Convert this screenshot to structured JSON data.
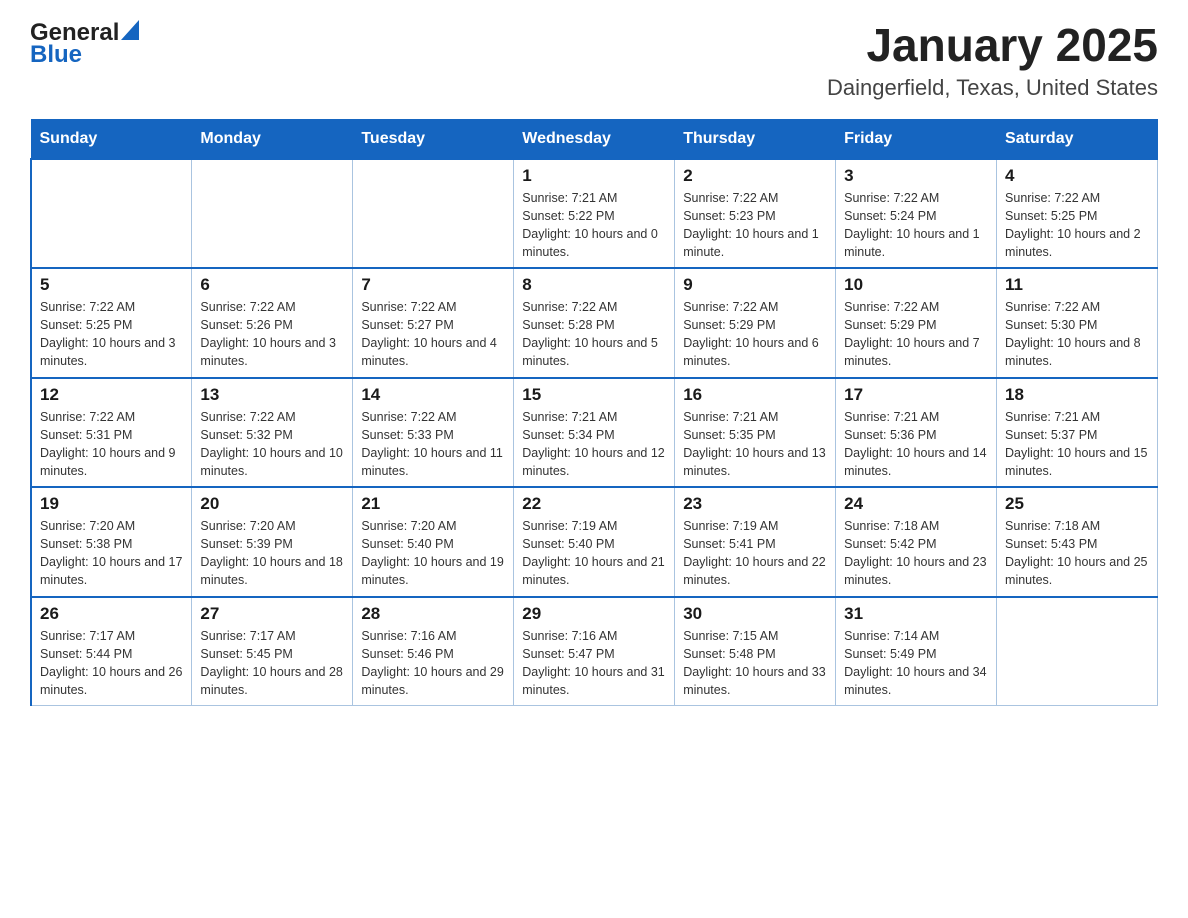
{
  "header": {
    "logo_general": "General",
    "logo_blue": "Blue",
    "title": "January 2025",
    "subtitle": "Daingerfield, Texas, United States"
  },
  "weekdays": [
    "Sunday",
    "Monday",
    "Tuesday",
    "Wednesday",
    "Thursday",
    "Friday",
    "Saturday"
  ],
  "weeks": [
    [
      {
        "day": "",
        "info": ""
      },
      {
        "day": "",
        "info": ""
      },
      {
        "day": "",
        "info": ""
      },
      {
        "day": "1",
        "info": "Sunrise: 7:21 AM\nSunset: 5:22 PM\nDaylight: 10 hours and 0 minutes."
      },
      {
        "day": "2",
        "info": "Sunrise: 7:22 AM\nSunset: 5:23 PM\nDaylight: 10 hours and 1 minute."
      },
      {
        "day": "3",
        "info": "Sunrise: 7:22 AM\nSunset: 5:24 PM\nDaylight: 10 hours and 1 minute."
      },
      {
        "day": "4",
        "info": "Sunrise: 7:22 AM\nSunset: 5:25 PM\nDaylight: 10 hours and 2 minutes."
      }
    ],
    [
      {
        "day": "5",
        "info": "Sunrise: 7:22 AM\nSunset: 5:25 PM\nDaylight: 10 hours and 3 minutes."
      },
      {
        "day": "6",
        "info": "Sunrise: 7:22 AM\nSunset: 5:26 PM\nDaylight: 10 hours and 3 minutes."
      },
      {
        "day": "7",
        "info": "Sunrise: 7:22 AM\nSunset: 5:27 PM\nDaylight: 10 hours and 4 minutes."
      },
      {
        "day": "8",
        "info": "Sunrise: 7:22 AM\nSunset: 5:28 PM\nDaylight: 10 hours and 5 minutes."
      },
      {
        "day": "9",
        "info": "Sunrise: 7:22 AM\nSunset: 5:29 PM\nDaylight: 10 hours and 6 minutes."
      },
      {
        "day": "10",
        "info": "Sunrise: 7:22 AM\nSunset: 5:29 PM\nDaylight: 10 hours and 7 minutes."
      },
      {
        "day": "11",
        "info": "Sunrise: 7:22 AM\nSunset: 5:30 PM\nDaylight: 10 hours and 8 minutes."
      }
    ],
    [
      {
        "day": "12",
        "info": "Sunrise: 7:22 AM\nSunset: 5:31 PM\nDaylight: 10 hours and 9 minutes."
      },
      {
        "day": "13",
        "info": "Sunrise: 7:22 AM\nSunset: 5:32 PM\nDaylight: 10 hours and 10 minutes."
      },
      {
        "day": "14",
        "info": "Sunrise: 7:22 AM\nSunset: 5:33 PM\nDaylight: 10 hours and 11 minutes."
      },
      {
        "day": "15",
        "info": "Sunrise: 7:21 AM\nSunset: 5:34 PM\nDaylight: 10 hours and 12 minutes."
      },
      {
        "day": "16",
        "info": "Sunrise: 7:21 AM\nSunset: 5:35 PM\nDaylight: 10 hours and 13 minutes."
      },
      {
        "day": "17",
        "info": "Sunrise: 7:21 AM\nSunset: 5:36 PM\nDaylight: 10 hours and 14 minutes."
      },
      {
        "day": "18",
        "info": "Sunrise: 7:21 AM\nSunset: 5:37 PM\nDaylight: 10 hours and 15 minutes."
      }
    ],
    [
      {
        "day": "19",
        "info": "Sunrise: 7:20 AM\nSunset: 5:38 PM\nDaylight: 10 hours and 17 minutes."
      },
      {
        "day": "20",
        "info": "Sunrise: 7:20 AM\nSunset: 5:39 PM\nDaylight: 10 hours and 18 minutes."
      },
      {
        "day": "21",
        "info": "Sunrise: 7:20 AM\nSunset: 5:40 PM\nDaylight: 10 hours and 19 minutes."
      },
      {
        "day": "22",
        "info": "Sunrise: 7:19 AM\nSunset: 5:40 PM\nDaylight: 10 hours and 21 minutes."
      },
      {
        "day": "23",
        "info": "Sunrise: 7:19 AM\nSunset: 5:41 PM\nDaylight: 10 hours and 22 minutes."
      },
      {
        "day": "24",
        "info": "Sunrise: 7:18 AM\nSunset: 5:42 PM\nDaylight: 10 hours and 23 minutes."
      },
      {
        "day": "25",
        "info": "Sunrise: 7:18 AM\nSunset: 5:43 PM\nDaylight: 10 hours and 25 minutes."
      }
    ],
    [
      {
        "day": "26",
        "info": "Sunrise: 7:17 AM\nSunset: 5:44 PM\nDaylight: 10 hours and 26 minutes."
      },
      {
        "day": "27",
        "info": "Sunrise: 7:17 AM\nSunset: 5:45 PM\nDaylight: 10 hours and 28 minutes."
      },
      {
        "day": "28",
        "info": "Sunrise: 7:16 AM\nSunset: 5:46 PM\nDaylight: 10 hours and 29 minutes."
      },
      {
        "day": "29",
        "info": "Sunrise: 7:16 AM\nSunset: 5:47 PM\nDaylight: 10 hours and 31 minutes."
      },
      {
        "day": "30",
        "info": "Sunrise: 7:15 AM\nSunset: 5:48 PM\nDaylight: 10 hours and 33 minutes."
      },
      {
        "day": "31",
        "info": "Sunrise: 7:14 AM\nSunset: 5:49 PM\nDaylight: 10 hours and 34 minutes."
      },
      {
        "day": "",
        "info": ""
      }
    ]
  ]
}
